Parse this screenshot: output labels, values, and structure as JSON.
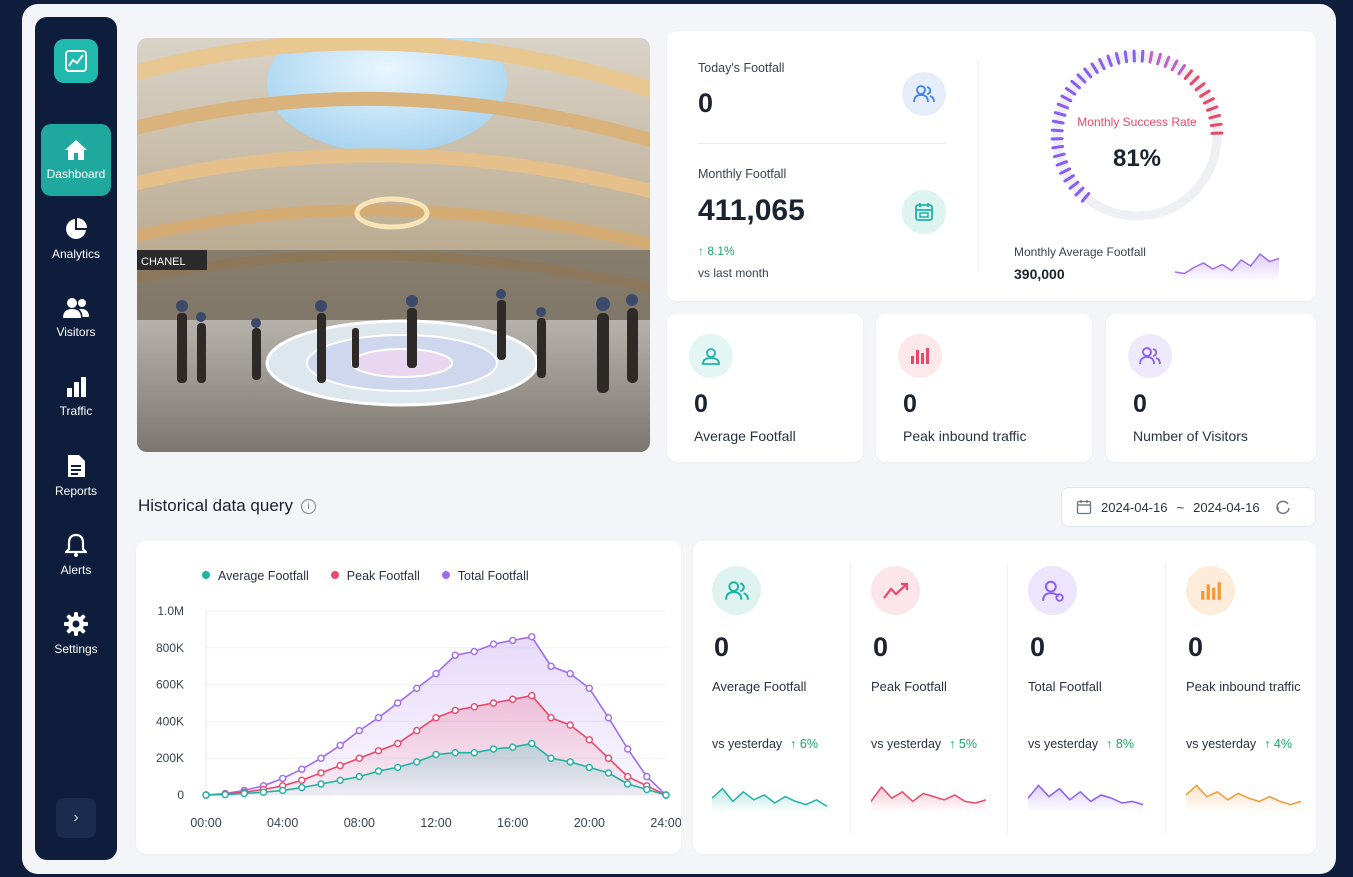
{
  "nav": {
    "items": [
      {
        "label": "Dashboard",
        "icon": "home-icon"
      },
      {
        "label": "Analytics",
        "icon": "pie-chart-icon"
      },
      {
        "label": "Visitors",
        "icon": "users-icon"
      },
      {
        "label": "Traffic",
        "icon": "bar-chart-icon"
      },
      {
        "label": "Reports",
        "icon": "document-icon"
      },
      {
        "label": "Alerts",
        "icon": "bell-icon"
      },
      {
        "label": "Settings",
        "icon": "gear-icon"
      }
    ],
    "collapse": "›"
  },
  "photo": {
    "store_sign": "CHANEL"
  },
  "summary": {
    "today_label": "Today's Footfall",
    "today_value": "0",
    "monthly_label": "Monthly Footfall",
    "monthly_value": "411,065",
    "monthly_change": "↑ 8.1%",
    "monthly_change_note": "vs last month",
    "gauge_label": "Monthly Success Rate",
    "gauge_value": "81%",
    "gauge_fraction": 0.81,
    "avg_label": "Monthly Average Footfall",
    "avg_value": "390,000"
  },
  "mini_cards": [
    {
      "value": "0",
      "label": "Average Footfall",
      "icon": "user-badge-icon",
      "color": "#1fb3a5",
      "bg": "#e3f6f3"
    },
    {
      "value": "0",
      "label": "Peak inbound traffic",
      "icon": "bar-chart-icon",
      "color": "#e8496a",
      "bg": "#fde8ec"
    },
    {
      "value": "0",
      "label": "Number of Visitors",
      "icon": "users-icon",
      "color": "#8b5cf6",
      "bg": "#efe9fd"
    }
  ],
  "history": {
    "title": "Historical data query",
    "date_from": "2024-04-16",
    "date_sep": "~",
    "date_to": "2024-04-16"
  },
  "colors": {
    "teal": "#1fb3a5",
    "red": "#e8496a",
    "purple": "#a06cf0",
    "orange": "#f2993a"
  },
  "chart_data": {
    "type": "line",
    "x": [
      "00:00",
      "01:00",
      "02:00",
      "03:00",
      "04:00",
      "05:00",
      "06:00",
      "07:00",
      "08:00",
      "09:00",
      "10:00",
      "11:00",
      "12:00",
      "13:00",
      "14:00",
      "15:00",
      "16:00",
      "17:00",
      "18:00",
      "19:00",
      "20:00",
      "21:00",
      "22:00",
      "23:00",
      "24:00"
    ],
    "x_ticks": [
      "00:00",
      "04:00",
      "08:00",
      "12:00",
      "16:00",
      "20:00",
      "24:00"
    ],
    "y_ticks": [
      "0",
      "200K",
      "400K",
      "600K",
      "800K",
      "1.0M"
    ],
    "ylim": [
      0,
      1000000
    ],
    "series": [
      {
        "name": "Average Footfall",
        "color": "#1fb3a5",
        "values": [
          0,
          2000,
          8000,
          15000,
          25000,
          40000,
          60000,
          80000,
          100000,
          130000,
          150000,
          180000,
          220000,
          230000,
          230000,
          250000,
          260000,
          280000,
          200000,
          180000,
          150000,
          120000,
          60000,
          30000,
          0
        ]
      },
      {
        "name": "Peak Footfall",
        "color": "#e8496a",
        "values": [
          0,
          5000,
          15000,
          30000,
          50000,
          80000,
          120000,
          160000,
          200000,
          240000,
          280000,
          350000,
          420000,
          460000,
          480000,
          500000,
          520000,
          540000,
          420000,
          380000,
          300000,
          200000,
          100000,
          50000,
          0
        ]
      },
      {
        "name": "Total Footfall",
        "color": "#a06cf0",
        "values": [
          0,
          8000,
          25000,
          50000,
          90000,
          140000,
          200000,
          270000,
          350000,
          420000,
          500000,
          580000,
          660000,
          760000,
          780000,
          820000,
          840000,
          860000,
          700000,
          660000,
          580000,
          420000,
          250000,
          100000,
          0
        ]
      }
    ],
    "legend": "top-left",
    "grid": true
  },
  "stats": [
    {
      "value": "0",
      "label": "Average Footfall",
      "cmp_label": "vs yesterday",
      "cmp_value": "↑ 6%",
      "icon": "users-icon",
      "color": "#1fb3a5",
      "bg": "#dff4f1",
      "spark": [
        0.4,
        0.7,
        0.3,
        0.6,
        0.35,
        0.5,
        0.25,
        0.45,
        0.3,
        0.2,
        0.35,
        0.15
      ]
    },
    {
      "value": "0",
      "label": "Peak Footfall",
      "cmp_label": "vs yesterday",
      "cmp_value": "↑ 5%",
      "icon": "trend-up-icon",
      "color": "#e8496a",
      "bg": "#fde6ea",
      "spark": [
        0.3,
        0.75,
        0.4,
        0.6,
        0.3,
        0.55,
        0.45,
        0.35,
        0.5,
        0.3,
        0.25,
        0.35
      ]
    },
    {
      "value": "0",
      "label": "Total Footfall",
      "cmp_label": "vs yesterday",
      "cmp_value": "↑ 8%",
      "icon": "user-badge-icon",
      "color": "#8b5cf6",
      "bg": "#ece5fd",
      "spark": [
        0.4,
        0.8,
        0.45,
        0.7,
        0.35,
        0.6,
        0.3,
        0.5,
        0.4,
        0.25,
        0.3,
        0.2
      ]
    },
    {
      "value": "0",
      "label": "Peak inbound traffic",
      "cmp_label": "vs yesterday",
      "cmp_value": "↑ 4%",
      "icon": "bar-chart-icon",
      "color": "#f2993a",
      "bg": "#fdecd9",
      "spark": [
        0.5,
        0.8,
        0.45,
        0.6,
        0.35,
        0.55,
        0.4,
        0.3,
        0.45,
        0.3,
        0.2,
        0.3
      ]
    }
  ],
  "avg_spark": [
    0.3,
    0.25,
    0.45,
    0.6,
    0.4,
    0.55,
    0.35,
    0.7,
    0.5,
    0.9,
    0.65,
    0.75
  ]
}
